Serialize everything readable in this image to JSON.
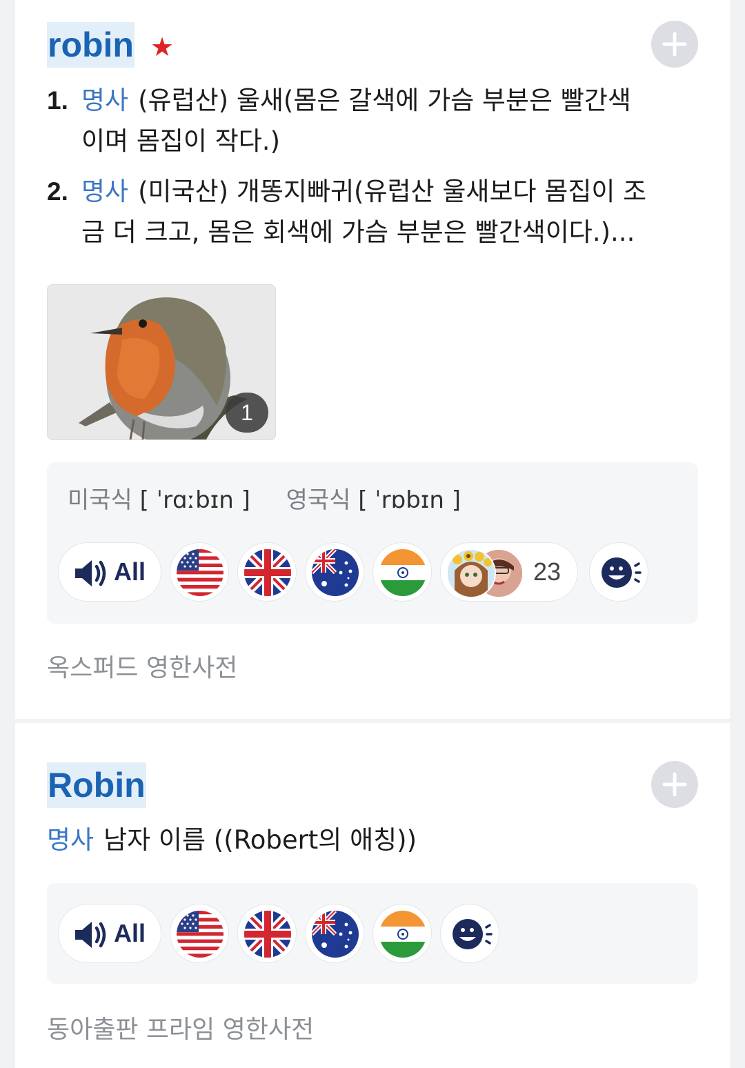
{
  "entries": [
    {
      "headword": "robin",
      "senses": [
        {
          "num": "1.",
          "pos": "명사",
          "line1": "(유럽산) 울새(몸은 갈색에 가슴 부분은 빨간색",
          "line2": "이며 몸집이 작다.)"
        },
        {
          "num": "2.",
          "pos": "명사",
          "line1": "(미국산) 개똥지빠귀(유럽산 울새보다 몸집이 조",
          "line2": "금 더 크고, 몸은 회색에 가슴 부분은 빨간색이다.)..."
        }
      ],
      "image_count": "1",
      "pronunciation": {
        "us_label": "미국식",
        "us_ipa": "[ ˈrɑːbɪn ]",
        "uk_label": "영국식",
        "uk_ipa": "[ ˈrɒbɪn ]"
      },
      "audio": {
        "all_label": "All",
        "user_count": "23"
      },
      "source": "옥스퍼드 영한사전"
    },
    {
      "headword": "Robin",
      "pos": "명사",
      "definition": "남자 이름 ((Robert의 애칭))",
      "audio": {
        "all_label": "All"
      },
      "source": "동아출판 프라임 영한사전"
    }
  ],
  "colors": {
    "headword": "#1a63b3",
    "headword_bg": "#e2eef8",
    "pos": "#3a78c3",
    "star": "#e02323",
    "source": "#8c9096"
  },
  "icons": [
    "star-icon",
    "plus-icon",
    "speaker-icon",
    "us-flag-icon",
    "uk-flag-icon",
    "au-flag-icon",
    "in-flag-icon",
    "voice-record-icon"
  ]
}
